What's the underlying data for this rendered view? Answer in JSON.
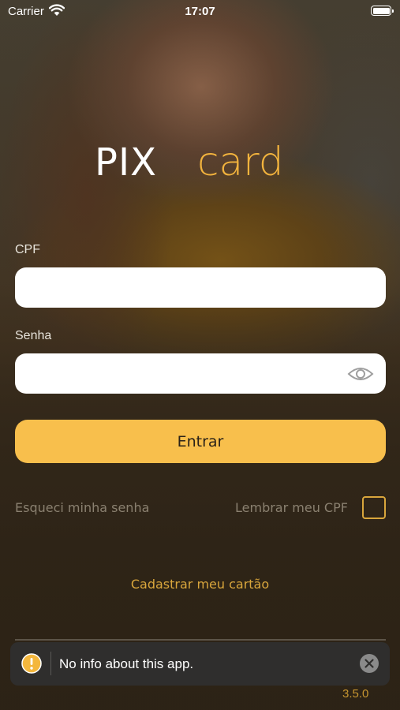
{
  "status_bar": {
    "carrier": "Carrier",
    "time": "17:07",
    "wifi_icon": "wifi-icon",
    "battery_icon": "battery-icon"
  },
  "logo": {
    "part1": "PIX",
    "part2": "card",
    "part1_color": "#ffffff",
    "part2_color": "#f2b33d"
  },
  "form": {
    "cpf_label": "CPF",
    "cpf_value": "",
    "senha_label": "Senha",
    "senha_value": "",
    "eye_icon": "eye-icon",
    "submit_label": "Entrar"
  },
  "links": {
    "forgot_password": "Esqueci minha senha",
    "remember_cpf": "Lembrar meu CPF",
    "remember_cpf_checked": false,
    "register_card": "Cadastrar meu cartão"
  },
  "toast": {
    "message": "No info about this app.",
    "info_icon": "info-icon",
    "close_icon": "close-icon"
  },
  "version": "3.5.0",
  "colors": {
    "accent": "#f8bf4c",
    "link_gold": "#d9a63c",
    "muted_text": "#8a8070"
  }
}
